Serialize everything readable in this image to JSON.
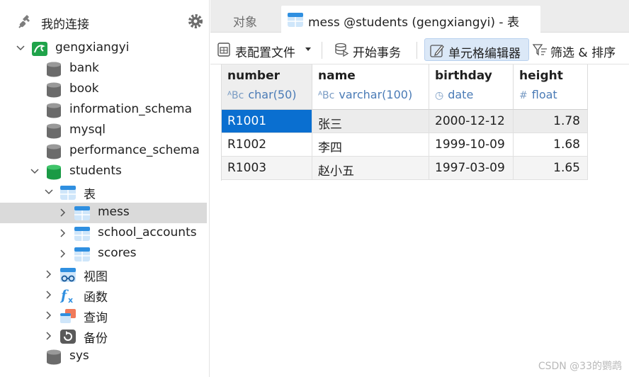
{
  "sidebar": {
    "title": "我的连接",
    "connection": "gengxiangyi",
    "databases": [
      "bank",
      "book",
      "information_schema",
      "mysql",
      "performance_schema",
      "students",
      "sys"
    ],
    "tables_group": "表",
    "tables": [
      "mess",
      "school_accounts",
      "scores"
    ],
    "others": [
      "视图",
      "函数",
      "查询",
      "备份"
    ]
  },
  "tabs": {
    "objects": "对象",
    "active": "mess @students (gengxiangyi) - 表"
  },
  "toolbar": {
    "profile": "表配置文件",
    "begin_tx": "开始事务",
    "cell_editor": "单元格编辑器",
    "filter_sort": "筛选 & 排序"
  },
  "table": {
    "columns": [
      {
        "name": "number",
        "type": "char(50)",
        "type_glyph": "ABC"
      },
      {
        "name": "name",
        "type": "varchar(100)",
        "type_glyph": "ABC"
      },
      {
        "name": "birthday",
        "type": "date",
        "type_glyph": "clock"
      },
      {
        "name": "height",
        "type": "float",
        "type_glyph": "#"
      }
    ],
    "rows": [
      [
        "R1001",
        "张三",
        "2000-12-12",
        "1.78"
      ],
      [
        "R1002",
        "李四",
        "1999-10-09",
        "1.68"
      ],
      [
        "R1003",
        "赵小五",
        "1997-03-09",
        "1.65"
      ]
    ]
  },
  "watermark": "CSDN @33的鹦鹉",
  "colors": {
    "accent": "#0a6fd0",
    "db_gray": "#6b6b6b",
    "db_green": "#1fa34a",
    "table_blue": "#2f8fe0"
  }
}
